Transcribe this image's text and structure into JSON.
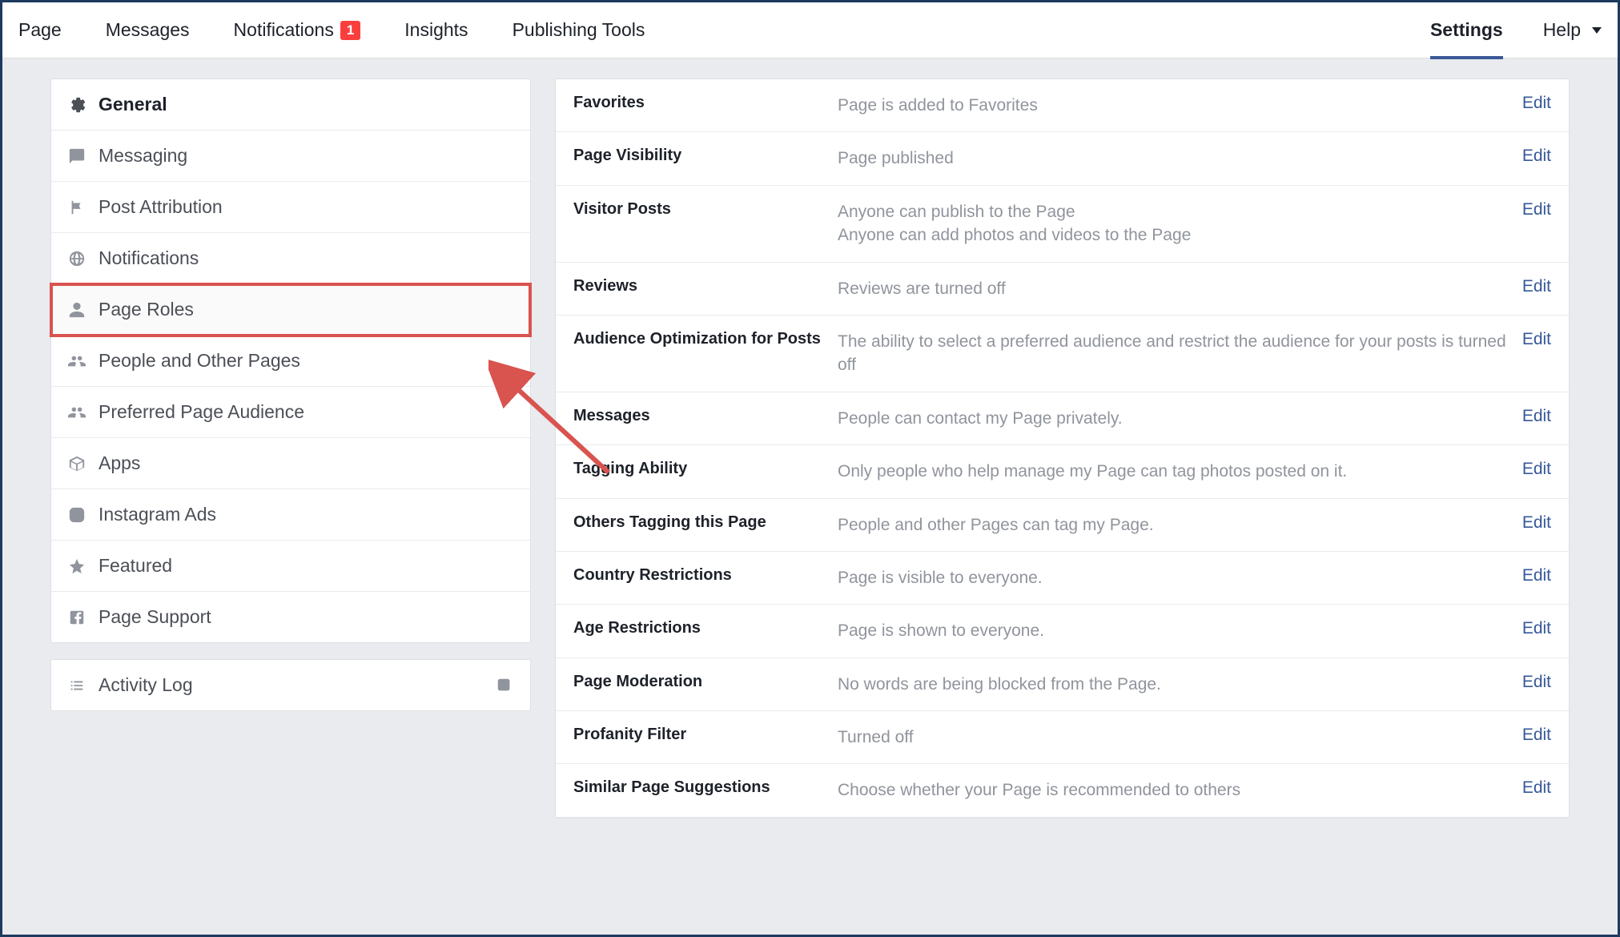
{
  "topnav": {
    "left": [
      {
        "label": "Page"
      },
      {
        "label": "Messages"
      },
      {
        "label": "Notifications",
        "badge": "1"
      },
      {
        "label": "Insights"
      },
      {
        "label": "Publishing Tools"
      }
    ],
    "right": [
      {
        "label": "Settings",
        "active": true
      },
      {
        "label": "Help",
        "dropdown": true
      }
    ]
  },
  "sidebar": {
    "items": [
      {
        "label": "General",
        "icon": "gear",
        "active": true
      },
      {
        "label": "Messaging",
        "icon": "chat"
      },
      {
        "label": "Post Attribution",
        "icon": "flag"
      },
      {
        "label": "Notifications",
        "icon": "globe"
      },
      {
        "label": "Page Roles",
        "icon": "person",
        "highlighted": true
      },
      {
        "label": "People and Other Pages",
        "icon": "people"
      },
      {
        "label": "Preferred Page Audience",
        "icon": "people"
      },
      {
        "label": "Apps",
        "icon": "box"
      },
      {
        "label": "Instagram Ads",
        "icon": "instagram"
      },
      {
        "label": "Featured",
        "icon": "star"
      },
      {
        "label": "Page Support",
        "icon": "fb"
      }
    ],
    "activity": {
      "label": "Activity Log",
      "icon": "list"
    }
  },
  "settings": {
    "edit_label": "Edit",
    "rows": [
      {
        "label": "Favorites",
        "value": "Page is added to Favorites"
      },
      {
        "label": "Page Visibility",
        "value": "Page published"
      },
      {
        "label": "Visitor Posts",
        "value": "Anyone can publish to the Page\nAnyone can add photos and videos to the Page"
      },
      {
        "label": "Reviews",
        "value": "Reviews are turned off"
      },
      {
        "label": "Audience Optimization for Posts",
        "value": "The ability to select a preferred audience and restrict the audience for your posts is turned off"
      },
      {
        "label": "Messages",
        "value": "People can contact my Page privately."
      },
      {
        "label": "Tagging Ability",
        "value": "Only people who help manage my Page can tag photos posted on it."
      },
      {
        "label": "Others Tagging this Page",
        "value": "People and other Pages can tag my Page."
      },
      {
        "label": "Country Restrictions",
        "value": "Page is visible to everyone."
      },
      {
        "label": "Age Restrictions",
        "value": "Page is shown to everyone."
      },
      {
        "label": "Page Moderation",
        "value": "No words are being blocked from the Page."
      },
      {
        "label": "Profanity Filter",
        "value": "Turned off"
      },
      {
        "label": "Similar Page Suggestions",
        "value": "Choose whether your Page is recommended to others"
      }
    ]
  }
}
